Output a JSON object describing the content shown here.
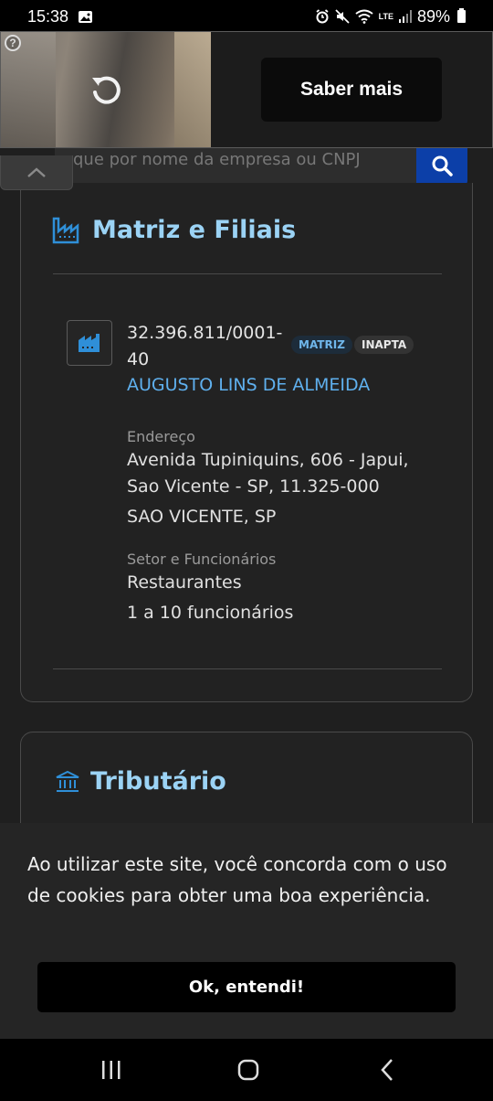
{
  "status_bar": {
    "time": "15:38",
    "battery": "89%",
    "network_label": "LTE"
  },
  "ad": {
    "help_icon": "help-icon",
    "replay_icon": "replay-icon",
    "cta_label": "Saber mais"
  },
  "search": {
    "placeholder": "que por nome da empresa ou CNPJ",
    "button_icon": "search-icon"
  },
  "matriz_card": {
    "title": "Matriz e Filiais",
    "title_icon": "factory-icon",
    "cnpj": "32.396.811/0001-40",
    "badges": [
      "MATRIZ",
      "INAPTA"
    ],
    "company_name": "AUGUSTO LINS DE ALMEIDA",
    "address_label": "Endereço",
    "address_line": "Avenida Tupiniquins, 606 - Japui, Sao Vicente - SP, 11.325-000",
    "city": "SAO VICENTE, SP",
    "sector_label": "Setor e Funcionários",
    "sector": "Restaurantes",
    "employees": "1 a 10 funcionários"
  },
  "tributario_card": {
    "title": "Tributário",
    "title_icon": "bank-icon"
  },
  "cookie": {
    "text": "Ao utilizar este site, você concorda com o uso de cookies para obter uma boa experiência.",
    "button_label": "Ok, entendi!"
  },
  "colors": {
    "accent_title": "#9bd3f5",
    "link": "#5fb0ee",
    "search_button": "#0c3fa8",
    "badge_matriz": "#6fb6ea"
  }
}
